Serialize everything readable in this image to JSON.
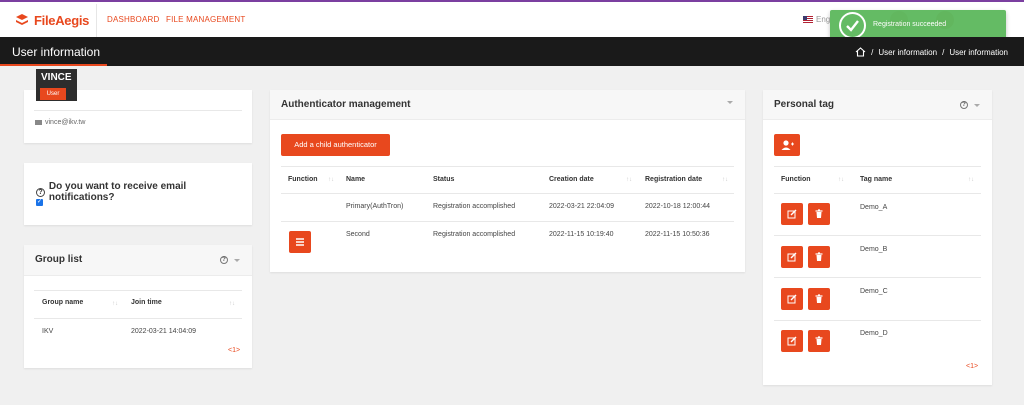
{
  "brand": {
    "name": "FileAegis"
  },
  "nav": {
    "dashboard": "DASHBOARD",
    "file_management": "FILE MANAGEMENT"
  },
  "lang": {
    "label": "Eng"
  },
  "toast": {
    "text": "Registration succeeded"
  },
  "header": {
    "title": "User information",
    "breadcrumb": [
      "User information",
      "User information"
    ]
  },
  "user": {
    "name": "VINCE",
    "role": "User",
    "email": "vince@ikv.tw"
  },
  "notifications": {
    "question": "Do you want to receive email notifications?",
    "checked": true
  },
  "group_list": {
    "title": "Group list",
    "columns": [
      "Group name",
      "Join time"
    ],
    "rows": [
      {
        "group": "IKV",
        "join_time": "2022-03-21 14:04:09"
      }
    ],
    "pager": "<1>"
  },
  "authenticators": {
    "title": "Authenticator management",
    "add_button": "Add a child authenticator",
    "columns": [
      "Function",
      "Name",
      "Status",
      "Creation date",
      "Registration date"
    ],
    "rows": [
      {
        "name": "Primary(AuthTron)",
        "status": "Registration accomplished",
        "created": "2022-03-21 22:04:09",
        "registered": "2022-10-18 12:00:44"
      },
      {
        "name": "Second",
        "status": "Registration accomplished",
        "created": "2022-11-15 10:19:40",
        "registered": "2022-11-15 10:50:36"
      }
    ]
  },
  "personal_tag": {
    "title": "Personal tag",
    "columns": [
      "Function",
      "Tag name"
    ],
    "rows": [
      "Demo_A",
      "Demo_B",
      "Demo_C",
      "Demo_D"
    ],
    "pager": "<1>"
  },
  "colors": {
    "accent": "#e8481e",
    "header_bg": "#1a1a1a",
    "toast_bg": "#5cb85c",
    "top_border": "#7b3fa0"
  }
}
